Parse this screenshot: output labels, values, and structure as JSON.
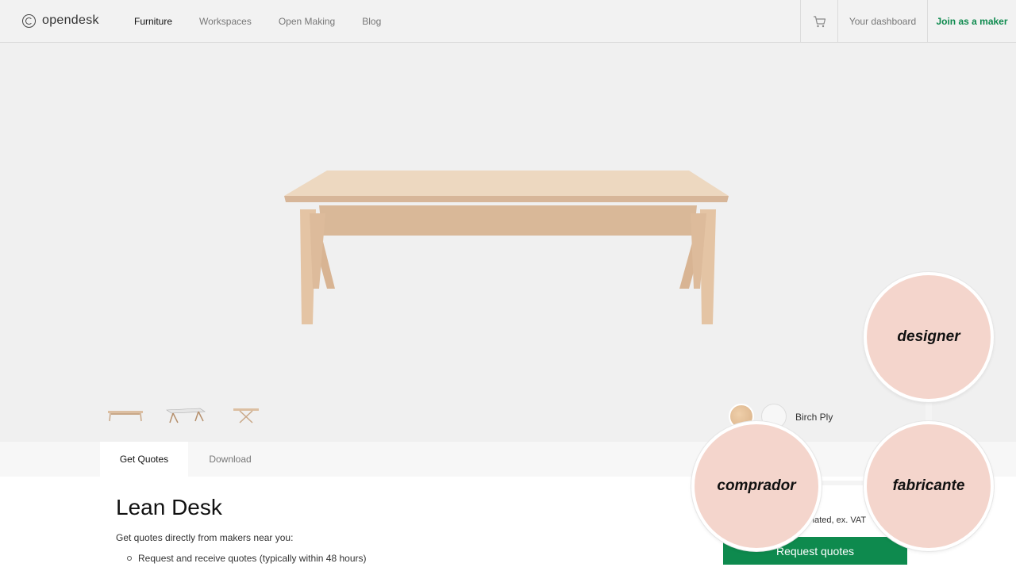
{
  "header": {
    "logo_text": "opendesk",
    "nav": [
      "Furniture",
      "Workspaces",
      "Open Making",
      "Blog"
    ],
    "dashboard_label": "Your dashboard",
    "join_label": "Join as a maker",
    "cart_icon": "cart-icon",
    "accent_color": "#0e8a4e"
  },
  "product": {
    "material_label": "Birch Ply",
    "swatches": [
      "wood",
      "white"
    ],
    "thumbnails": 3
  },
  "tabs": [
    "Get Quotes",
    "Download"
  ],
  "content": {
    "title": "Lean Desk",
    "intro": "Get quotes directly from makers near you:",
    "bullet": "Request and receive quotes (typically within 48 hours)",
    "price_note": "nated, ex. VAT",
    "cta": "Request quotes"
  },
  "roles": [
    "designer",
    "comprador",
    "fabricante"
  ]
}
